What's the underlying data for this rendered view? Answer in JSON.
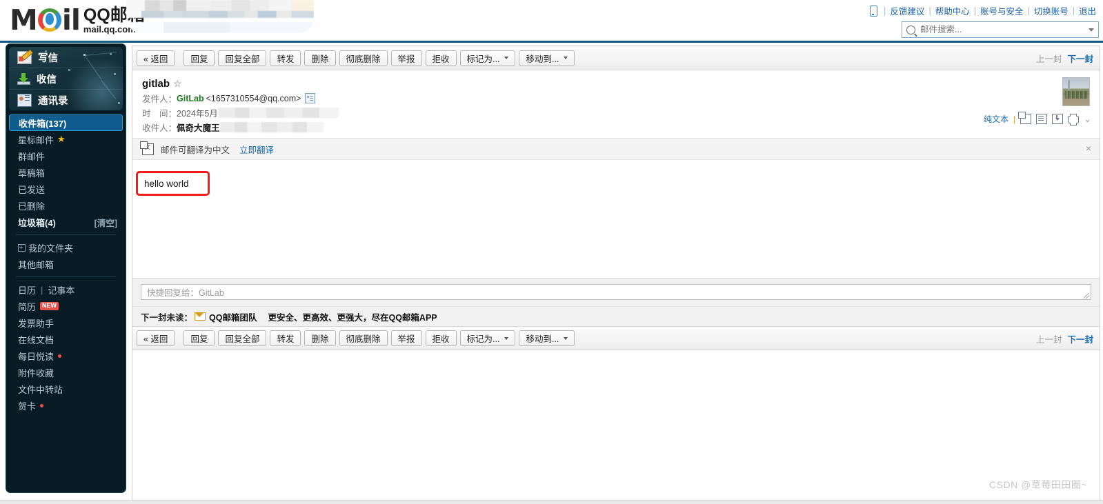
{
  "header": {
    "logo_cn": "QQ邮箱",
    "logo_url": "mail.qq.com",
    "logo_mark_left": "M",
    "logo_mark_right": "il",
    "links": [
      {
        "label": "反馈建议"
      },
      {
        "label": "帮助中心"
      },
      {
        "label": "账号与安全"
      },
      {
        "label": "切换账号"
      },
      {
        "label": "退出"
      }
    ],
    "separator": "|",
    "search": {
      "placeholder": "邮件搜索...",
      "value": ""
    }
  },
  "sidebar": {
    "compose": [
      {
        "label": "写信",
        "icon": "write-icon"
      },
      {
        "label": "收信",
        "icon": "receive-icon"
      },
      {
        "label": "通讯录",
        "icon": "contacts-icon"
      }
    ],
    "folders": [
      {
        "label": "收件箱(137)",
        "active": true
      },
      {
        "label": "星标邮件",
        "star": "★"
      },
      {
        "label": "群邮件"
      },
      {
        "label": "草稿箱"
      },
      {
        "label": "已发送"
      },
      {
        "label": "已删除"
      },
      {
        "label": "垃圾箱(4)",
        "right": "[清空]",
        "strong": true
      }
    ],
    "my_folders": "我的文件夹",
    "other_mailbox": "其他邮箱",
    "tools_row": {
      "calendar": "日历",
      "sep": "|",
      "notebook": "记事本"
    },
    "tools": [
      {
        "label": "简历",
        "badge": "NEW"
      },
      {
        "label": "发票助手"
      },
      {
        "label": "在线文档"
      },
      {
        "label": "每日悦读",
        "dot": true
      },
      {
        "label": "附件收藏"
      },
      {
        "label": "文件中转站"
      },
      {
        "label": "贺卡",
        "dot": true
      }
    ]
  },
  "toolbar": {
    "buttons": [
      {
        "label": "« 返回",
        "type": "back"
      },
      {
        "label": "回复"
      },
      {
        "label": "回复全部"
      },
      {
        "label": "转发"
      },
      {
        "label": "删除"
      },
      {
        "label": "彻底删除"
      },
      {
        "label": "举报"
      },
      {
        "label": "拒收"
      },
      {
        "label": "标记为...",
        "dropdown": true
      },
      {
        "label": "移动到...",
        "dropdown": true
      }
    ],
    "prev": "上一封",
    "next": "下一封"
  },
  "mail": {
    "subject": "gitlab",
    "star": "☆",
    "from_label": "发件人：",
    "from_name": "GitLab",
    "from_address": "<1657310554@qq.com>",
    "date_label": "时　间：",
    "date_value": "2024年5月",
    "to_label": "收件人：",
    "to_value": "佩奇大魔王",
    "plain_text_link": "纯文本",
    "actions": [
      "new-window-icon",
      "source-icon",
      "save-icon",
      "print-icon",
      "chevron-down-icon"
    ],
    "translate": {
      "text": "邮件可翻译为中文",
      "link": "立即翻译",
      "close": "×"
    },
    "body": "hello world"
  },
  "reply": {
    "placeholder": "快捷回复给：GitLab",
    "value": ""
  },
  "next_unread": {
    "label": "下一封未读：",
    "sender": "QQ邮箱团队",
    "text": "更安全、更高效、更强大，尽在QQ邮箱APP"
  },
  "watermark": "CSDN @草莓田田圈~",
  "colors": {
    "accent_blue": "#1a6bb0",
    "sidebar_bg": "#091c25",
    "active_folder": "#0f5c8f",
    "sender_green": "#1d7a1d",
    "annotation_red": "#f51b1b",
    "badge_red": "#e8514a"
  }
}
